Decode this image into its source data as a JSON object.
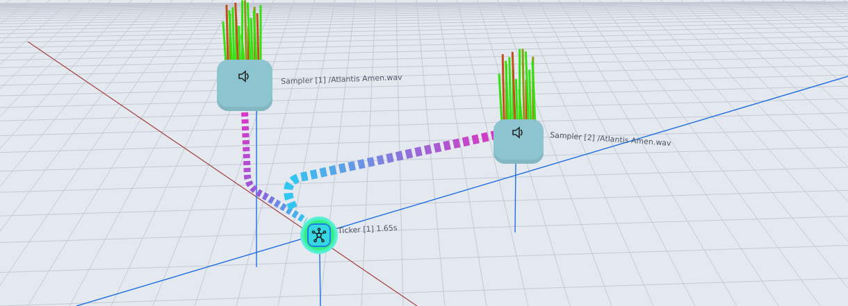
{
  "nodes": [
    {
      "kind": "sampler",
      "label": "Sampler [1] /Atlantis Amen.wav"
    },
    {
      "kind": "sampler",
      "label": "Sampler [2] /Atlantis Amen.wav"
    },
    {
      "kind": "ticker",
      "label": "Ticker [1] 1.65s"
    }
  ]
}
